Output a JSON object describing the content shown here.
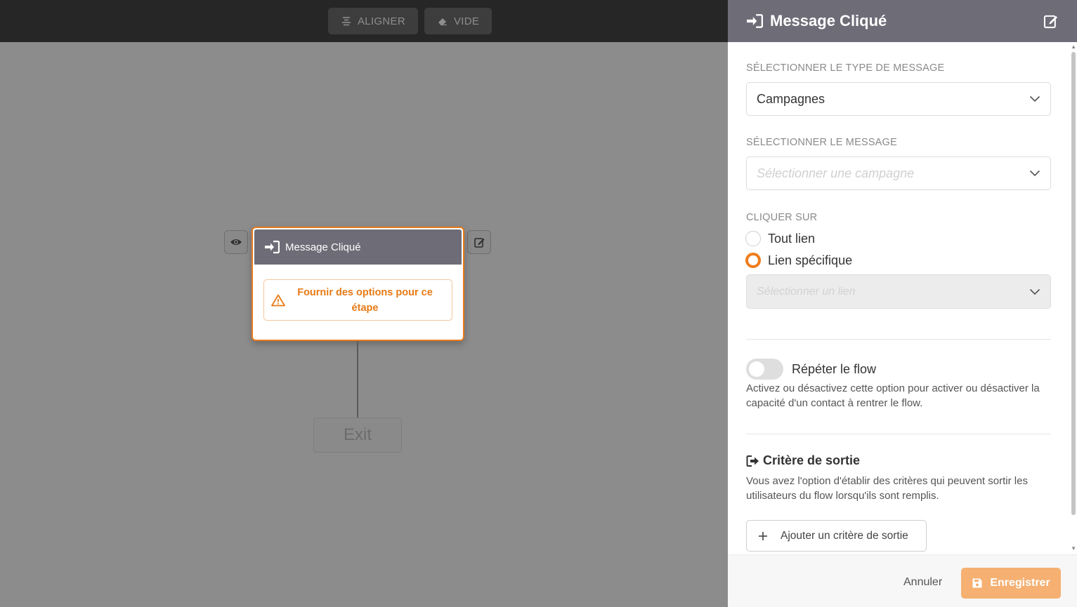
{
  "toolbar": {
    "align_label": "ALIGNER",
    "clear_label": "VIDE"
  },
  "canvas": {
    "node": {
      "title": "Message Cliqué",
      "warning": "Fournir des options pour ce étape"
    },
    "exit_label": "Exit"
  },
  "panel": {
    "title": "Message Cliqué",
    "message_type": {
      "label": "SÉLECTIONNER LE TYPE DE MESSAGE",
      "value": "Campagnes"
    },
    "message": {
      "label": "SÉLECTIONNER LE MESSAGE",
      "placeholder": "Sélectionner une campagne"
    },
    "click_on": {
      "label": "CLIQUER SUR",
      "options": [
        "Tout lien",
        "Lien spécifique"
      ],
      "selected": "Lien spécifique",
      "link_placeholder": "Sélectionner un lien"
    },
    "repeat": {
      "label": "Répéter le flow",
      "enabled": false,
      "help": "Activez ou désactivez cette option pour activer ou désactiver la capacité d'un contact à rentrer le flow."
    },
    "exit_criteria": {
      "title": "Critère de sortie",
      "help": "Vous avez l'option d'établir des critères qui peuvent sortir les utilisateurs du flow lorsqu'ils sont remplis.",
      "add_label": "Ajouter un critère de sortie"
    },
    "footer": {
      "cancel_label": "Annuler",
      "save_label": "Enregistrer"
    }
  },
  "colors": {
    "accent": "#ef7d1d",
    "header": "#6e6c77",
    "toolbar": "#262626"
  }
}
